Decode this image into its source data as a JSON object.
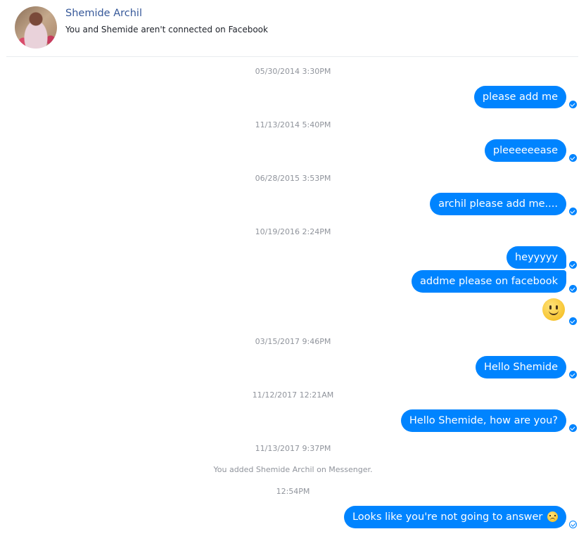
{
  "contact": {
    "name": "Shemide Archil",
    "subtitle": "You and Shemide aren't connected on Facebook",
    "avatar_icon": "profile-photo"
  },
  "colors": {
    "bubble": "#0084ff",
    "timestamp": "#90949c",
    "name": "#365899"
  },
  "timestamps": {
    "t1": "05/30/2014 3:30PM",
    "t2": "11/13/2014 5:40PM",
    "t3": "06/28/2015 3:53PM",
    "t4": "10/19/2016 2:24PM",
    "t5": "03/15/2017 9:46PM",
    "t6": "11/12/2017 12:21AM",
    "t7": "11/13/2017 9:37PM",
    "t8": "12:54PM"
  },
  "notice": "You added Shemide Archil on Messenger.",
  "messages": {
    "m1": "please add me",
    "m2": "pleeeeeease",
    "m3": "archil please add me....",
    "m4": "heyyyyy",
    "m5": "addme please on facebook",
    "m6_emoji": "slightly-smiling-face-emoji",
    "m7": "Hello Shemide",
    "m8": "Hello Shemide, how are you?",
    "m9": "Looks like you're not going to answer",
    "m9_emoji": "disappointed-face-emoji"
  },
  "status_icons": {
    "delivered": "delivered-check-icon",
    "sent": "sent-check-icon"
  }
}
